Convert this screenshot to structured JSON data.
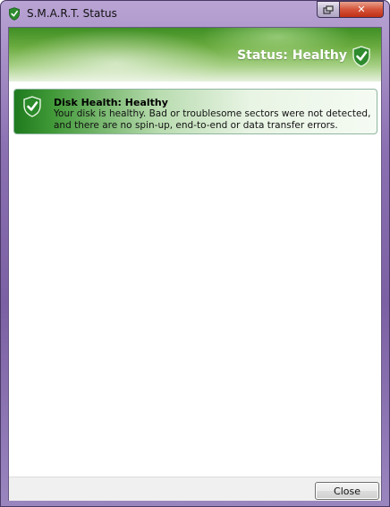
{
  "window": {
    "title": "S.M.A.R.T. Status",
    "title_icon": "shield-check-icon",
    "controls": {
      "restore_icon": "restore-icon",
      "close_icon": "close-icon",
      "close_glyph": "✕"
    }
  },
  "banner": {
    "status_text": "Status: Healthy",
    "icon": "shield-check-icon"
  },
  "health_panel": {
    "icon": "shield-check-icon",
    "heading": "Disk Health: Healthy",
    "description": "Your disk is healthy. Bad or troublesome sectors were not detected, and there are no spin-up, end-to-end or data transfer errors."
  },
  "footer": {
    "close_label": "Close"
  },
  "colors": {
    "healthy_green": "#2d8a2d",
    "banner_green": "#6aab3f",
    "window_frame": "#8a6fb1"
  }
}
